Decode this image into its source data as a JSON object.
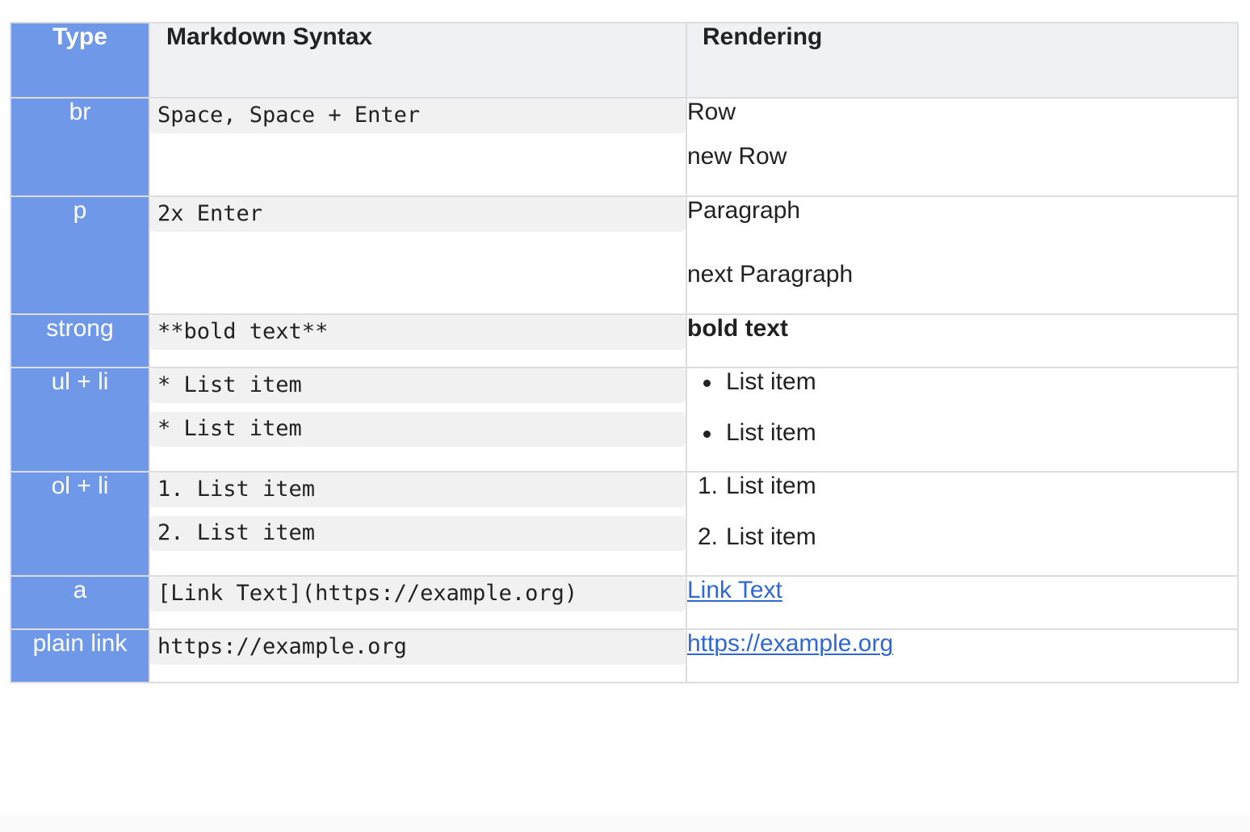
{
  "headers": {
    "type": "Type",
    "syntax": "Markdown Syntax",
    "rendering": "Rendering"
  },
  "colors": {
    "type_column_bg": "#6f98e9",
    "header_bg": "#f0f1f3",
    "code_bg": "#f1f1f1",
    "link": "#2f67d6",
    "border": "#dcdde0"
  },
  "rows": [
    {
      "type": "br",
      "syntax": [
        "Space, Space + Enter"
      ],
      "rendering": [
        "Row",
        "new Row"
      ]
    },
    {
      "type": "p",
      "syntax": [
        "2x Enter"
      ],
      "rendering": [
        "Paragraph",
        "next Paragraph"
      ]
    },
    {
      "type": "strong",
      "syntax": [
        "**bold text**"
      ],
      "rendering": [
        "bold text"
      ]
    },
    {
      "type": "ul + li",
      "syntax": [
        "* List item ",
        "* List item"
      ],
      "rendering": [
        "List item",
        "List item"
      ],
      "list_marker": "bullet-icon"
    },
    {
      "type": "ol + li",
      "syntax": [
        "1. List item ",
        "2. List item"
      ],
      "rendering": [
        "List item",
        "List item"
      ],
      "list_numbers": [
        "1.",
        "2."
      ]
    },
    {
      "type": "a",
      "syntax": [
        "[Link Text](https://example.org)"
      ],
      "rendering": [
        "Link Text"
      ]
    },
    {
      "type": "plain link",
      "syntax": [
        "https://example.org"
      ],
      "rendering": [
        "https://example.org"
      ]
    }
  ]
}
